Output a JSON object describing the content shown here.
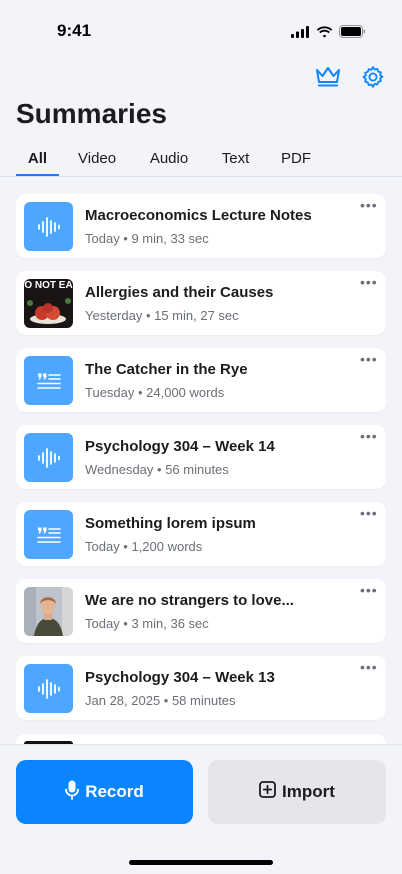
{
  "status_bar": {
    "time": "9:41"
  },
  "header": {
    "title": "Summaries",
    "actions": [
      {
        "icon": "crown-icon"
      },
      {
        "icon": "gear-icon"
      }
    ]
  },
  "tabs": [
    {
      "label": "All",
      "active": true
    },
    {
      "label": "Video",
      "active": false
    },
    {
      "label": "Audio",
      "active": false
    },
    {
      "label": "Text",
      "active": false
    },
    {
      "label": "PDF",
      "active": false
    }
  ],
  "summaries": [
    {
      "title": "Macroeconomics Lecture Notes",
      "meta": "Today • 9 min, 33 sec",
      "thumb": "audio-waveform-icon"
    },
    {
      "title": "Allergies and their Causes",
      "meta": "Yesterday • 15 min, 27 sec",
      "thumb": "video-thumbnail",
      "thumb_text": "O NOT EA"
    },
    {
      "title": "The Catcher in the Rye",
      "meta": "Tuesday • 24,000 words",
      "thumb": "text-quote-icon"
    },
    {
      "title": "Psychology 304 – Week 14",
      "meta": "Wednesday • 56 minutes",
      "thumb": "audio-waveform-icon"
    },
    {
      "title": "Something lorem ipsum",
      "meta": "Today • 1,200 words",
      "thumb": "text-quote-icon"
    },
    {
      "title": "We are no strangers to love...",
      "meta": "Today • 3 min, 36 sec",
      "thumb": "video-thumbnail-person"
    },
    {
      "title": "Psychology 304 – Week 13",
      "meta": "Jan 28, 2025 • 58 minutes",
      "thumb": "audio-waveform-icon"
    }
  ],
  "bottom_bar": {
    "record_label": "Record",
    "import_label": "Import"
  },
  "colors": {
    "accent": "#0a84ff",
    "thumb_blue": "#4da6ff",
    "background": "#f2f4fa"
  }
}
